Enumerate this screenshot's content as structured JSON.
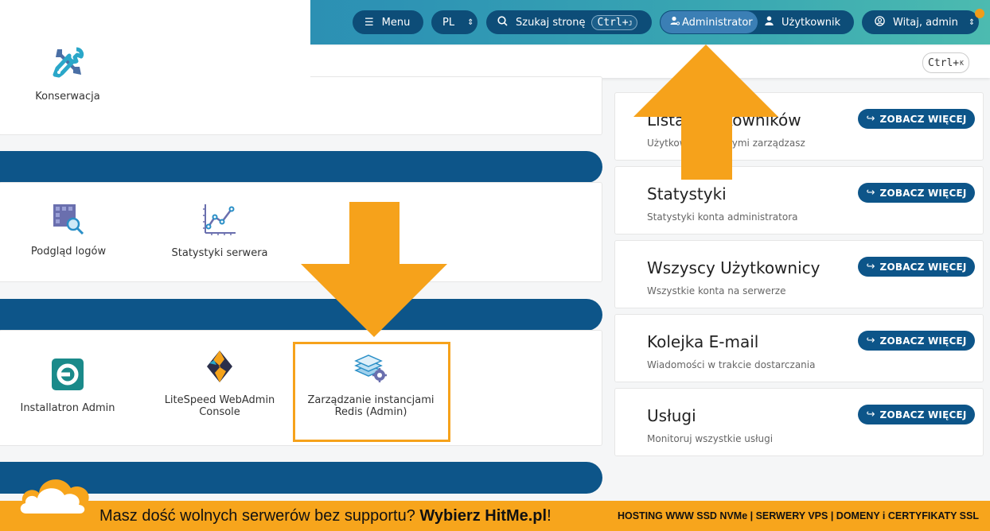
{
  "topbar": {
    "menu_label": "Menu",
    "lang_label": "PL",
    "search_label": "Szukaj stronę",
    "search_shortcut": "Ctrl+",
    "search_shortcut_key": "J",
    "role_admin_label": "Administrator",
    "role_user_label": "Użytkownik",
    "greeting_label": "Witaj, admin"
  },
  "searchbar": {
    "shortcut": "Ctrl+",
    "shortcut_key": "K"
  },
  "tools": {
    "maintenance": "Konserwacja",
    "log_viewer": "Podgląd logów",
    "server_stats": "Statystyki serwera",
    "installatron": "Installatron Admin",
    "litespeed": "LiteSpeed WebAdmin Console",
    "redis": "Zarządzanie instancjami Redis (Admin)"
  },
  "side_cards": [
    {
      "title": "Lista użytkowników",
      "subtitle": "Użytkownicy, którymi zarządzasz",
      "button": "ZOBACZ WIĘCEJ"
    },
    {
      "title": "Statystyki",
      "subtitle": "Statystyki konta administratora",
      "button": "ZOBACZ WIĘCEJ"
    },
    {
      "title": "Wszyscy Użytkownicy",
      "subtitle": "Wszystkie konta na serwerze",
      "button": "ZOBACZ WIĘCEJ"
    },
    {
      "title": "Kolejka E-mail",
      "subtitle": "Wiadomości w trakcie dostarczania",
      "button": "ZOBACZ WIĘCEJ"
    },
    {
      "title": "Usługi",
      "subtitle": "Monitoruj wszystkie usługi",
      "button": "ZOBACZ WIĘCEJ"
    }
  ],
  "footer": {
    "text": "Masz dość wolnych serwerów bez supportu? ",
    "brand": "Wybierz HitMe.pl",
    "exclaim": "!",
    "right": "HOSTING WWW SSD NVMe | SERWERY VPS | DOMENY i CERTYFIKATY SSL"
  },
  "colors": {
    "navy": "#0d5589",
    "pill": "#0d4d78",
    "orange": "#f6a21b",
    "footer": "#f7a51c"
  },
  "icons": [
    "menu-icon",
    "search-icon",
    "user-gear-icon",
    "user-icon",
    "account-circle-icon",
    "tools-icon",
    "log-view-icon",
    "chart-line-icon",
    "installatron-icon",
    "litespeed-icon",
    "redis-icon",
    "share-arrow-icon",
    "cloud-logo-icon"
  ]
}
